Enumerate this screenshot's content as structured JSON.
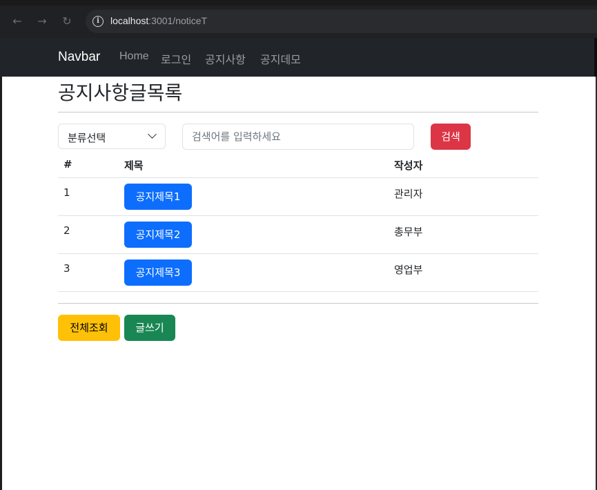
{
  "browser": {
    "url_host": "localhost",
    "url_rest": ":3001/noticeT",
    "back_icon": "arrow-left-icon",
    "forward_icon": "arrow-right-icon",
    "reload_icon": "reload-icon",
    "info_icon": "info-icon"
  },
  "navbar": {
    "brand": "Navbar",
    "links": [
      "Home",
      "로그인",
      "공지사항",
      "공지데모"
    ]
  },
  "page": {
    "title": "공지사항글목록"
  },
  "search": {
    "category_value": "분류선택",
    "placeholder": "검색어를 입력하세요",
    "button_label": "검색"
  },
  "table": {
    "headers": [
      "#",
      "제목",
      "작성자"
    ],
    "rows": [
      {
        "num": "1",
        "title": "공지제목1",
        "author": "관리자"
      },
      {
        "num": "2",
        "title": "공지제목2",
        "author": "총무부"
      },
      {
        "num": "3",
        "title": "공지제목3",
        "author": "영업부"
      }
    ]
  },
  "actions": {
    "view_all_label": "전체조회",
    "write_label": "글쓰기"
  },
  "colors": {
    "danger": "#dc3545",
    "primary": "#0d6efd",
    "warning": "#ffc107",
    "success": "#198754",
    "navbar": "#212529"
  }
}
